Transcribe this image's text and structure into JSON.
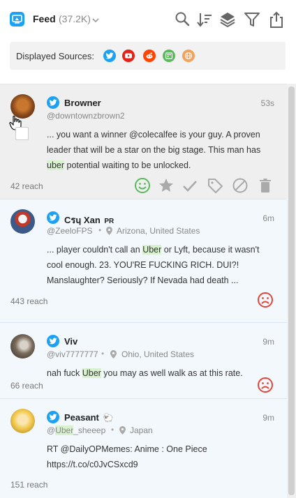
{
  "header": {
    "title": "Feed",
    "count": "(37.2K)",
    "icons": [
      "search-icon",
      "sort-icon",
      "layers-icon",
      "filter-icon",
      "share-icon"
    ]
  },
  "sources": {
    "label": "Displayed Sources:",
    "items": [
      {
        "name": "twitter",
        "color": "#1da1f2"
      },
      {
        "name": "youtube",
        "color": "#e62117"
      },
      {
        "name": "reddit",
        "color": "#ff4500"
      },
      {
        "name": "news",
        "color": "#5cb85c"
      },
      {
        "name": "web",
        "color": "#f0a35e"
      }
    ]
  },
  "posts": [
    {
      "author": "Browner",
      "flair": "",
      "handle": "@downtownzbrown2",
      "location": "",
      "time": "53s",
      "text_parts": [
        "... you want a winner @colecalfee is your guy. A proven leader that will be a star on the big stage. This man has ",
        "uber",
        " potential waiting to be unlocked."
      ],
      "reach": "42 reach",
      "sentiment": "positive",
      "actions": [
        "smile-icon",
        "star-icon",
        "check-icon",
        "tag-icon",
        "block-icon",
        "trash-icon"
      ]
    },
    {
      "author": "Cรɥ Xan",
      "flair": "PR",
      "handle": "@ZeeloFPS",
      "location": "Arizona, United States",
      "time": "6m",
      "text_parts": [
        "... player couldn't call an ",
        "Uber",
        " or Lyft, because it wasn't cool enough. 23. YOU'RE FUCKING RICH. DUI?! Manslaughter? Seriously? If Nevada had death ..."
      ],
      "reach": "443 reach",
      "sentiment": "negative"
    },
    {
      "author": "Viv",
      "flair": "",
      "handle": "@viv7777777",
      "location": "Ohio, United States",
      "time": "9m",
      "text_parts": [
        "nah fuck ",
        "Uber",
        " you may as well walk as at this rate."
      ],
      "reach": "66 reach",
      "sentiment": "negative"
    },
    {
      "author": "Peasant",
      "flair": "🐑",
      "handle_parts": [
        "@",
        "Uber",
        "_sheeep"
      ],
      "location": "Japan",
      "time": "9m",
      "text_parts": [
        "RT @DailyOPMemes: Anime : One Piece https://t.co/c0JvCSxcd9"
      ],
      "reach": "151 reach",
      "sentiment": "none"
    }
  ]
}
